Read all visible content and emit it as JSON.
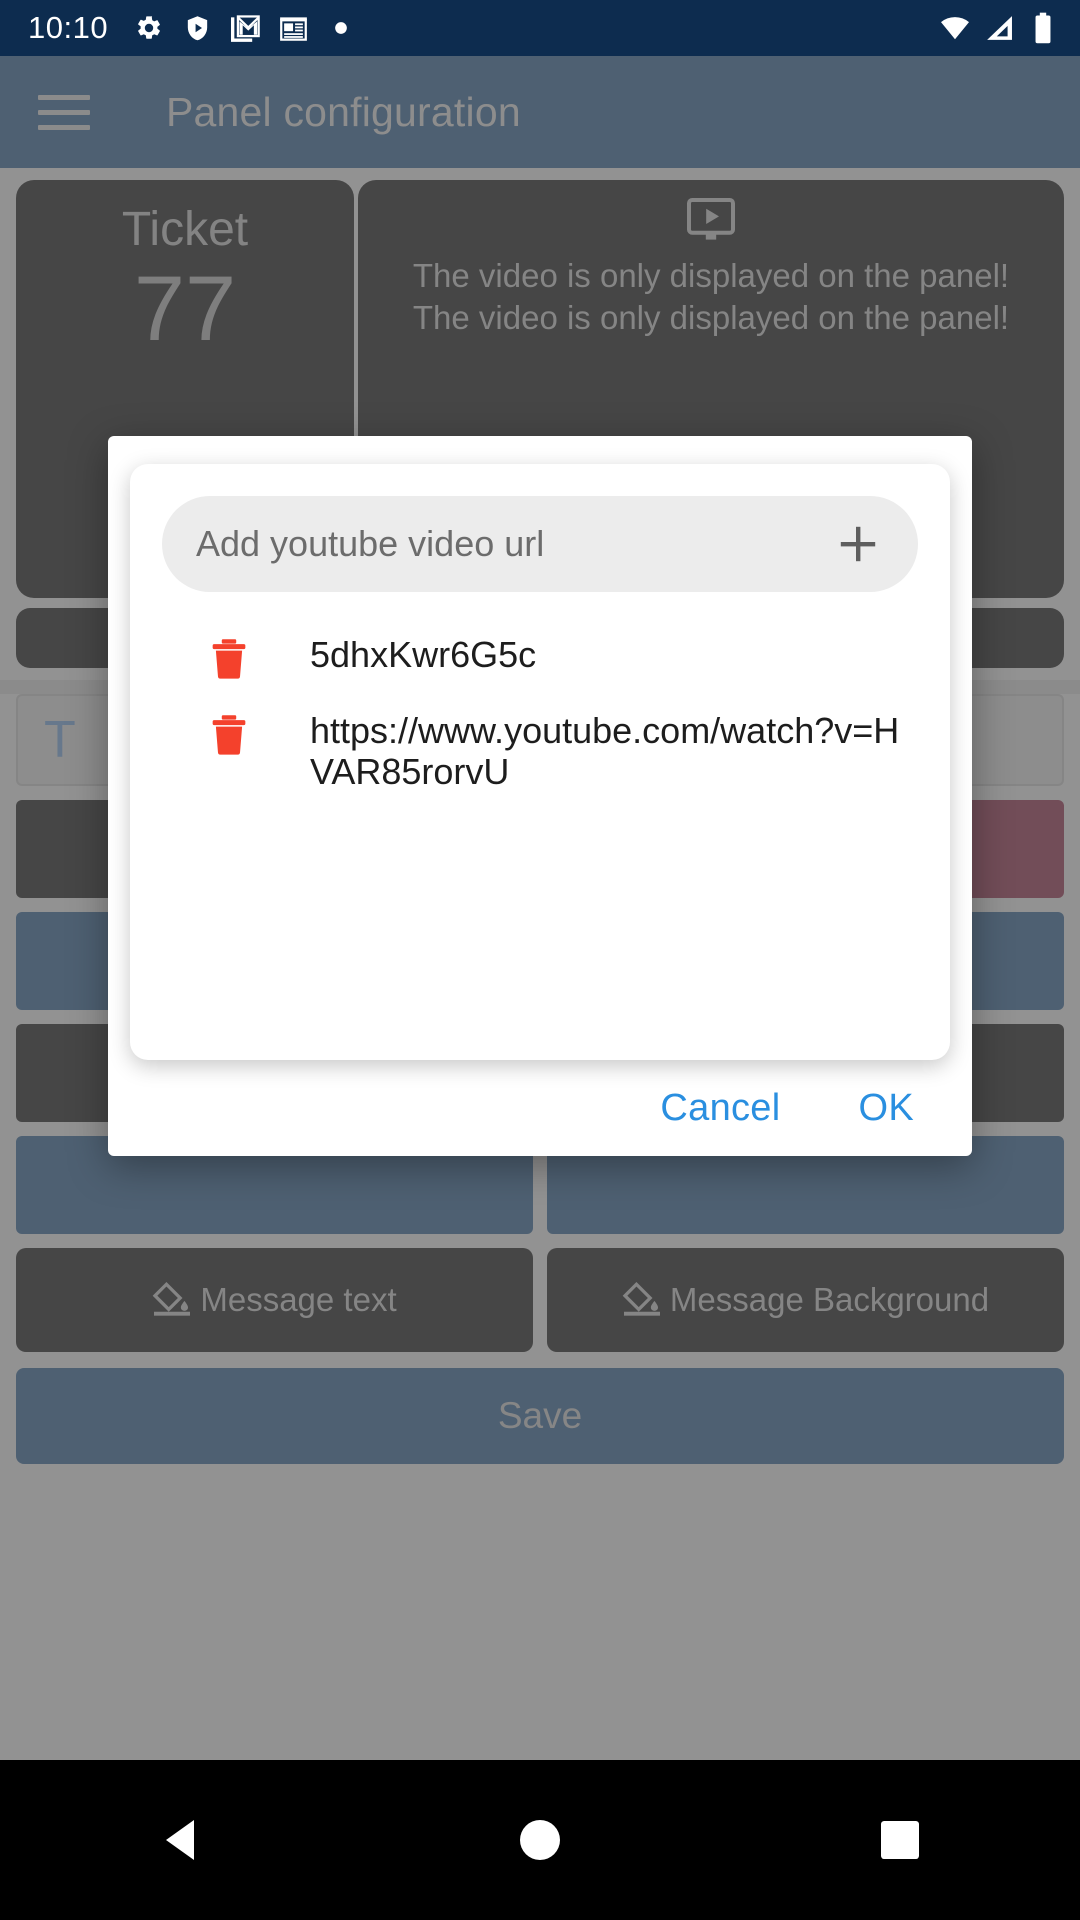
{
  "status_bar": {
    "clock": "10:10",
    "left_icons": [
      "gear-icon",
      "play-protect-shield-icon",
      "gmail-icon",
      "news-icon",
      "dot-icon"
    ],
    "right_icons": [
      "wifi-icon",
      "cellular-signal-icon",
      "battery-icon"
    ],
    "background_color": "#0d2c4f"
  },
  "app_bar": {
    "menu_icon": "hamburger-menu-icon",
    "title": "Panel configuration",
    "background_color": "#123a63",
    "title_color": "#9d9d9d"
  },
  "background_page": {
    "ticket_card": {
      "label": "Ticket",
      "number": "77"
    },
    "video_card": {
      "icon": "tv-play-icon",
      "line1": "The video is only displayed on the panel!",
      "line2": "The video is only displayed on the panel!"
    },
    "text_field_value": "T",
    "message_text_button": {
      "icon": "paint-fill-icon",
      "label": "Message text"
    },
    "message_background_button": {
      "icon": "paint-fill-icon",
      "label": "Message Background"
    },
    "save_button_label": "Save",
    "color_swatches": [
      "#000000",
      "#631029",
      "#123a63",
      "#123a63",
      "#000000",
      "#000000",
      "#123a63",
      "#123a63"
    ]
  },
  "dialog": {
    "input": {
      "value": "",
      "placeholder": "Add youtube video url",
      "add_icon": "plus-icon"
    },
    "items": [
      {
        "delete_icon": "trash-icon",
        "text": "5dhxKwr6G5c"
      },
      {
        "delete_icon": "trash-icon",
        "text": "https://www.youtube.com/watch?v=HVAR85rorvU"
      }
    ],
    "cancel_label": "Cancel",
    "ok_label": "OK",
    "accent_color": "#2a8fe0",
    "delete_icon_color": "#f4412c"
  },
  "nav_bar": {
    "back_icon": "back-triangle-icon",
    "home_icon": "home-circle-icon",
    "recents_icon": "recents-square-icon",
    "background_color": "#000000"
  }
}
